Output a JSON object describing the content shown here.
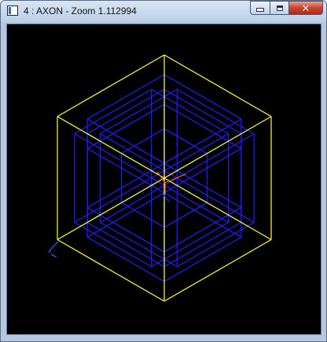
{
  "window": {
    "title": "4 : AXON - Zoom 1.112994",
    "controls": {
      "minimize": "minimize",
      "maximize": "maximize",
      "close": "close"
    }
  },
  "viewport": {
    "background": "#000000",
    "colors": {
      "outer_cube": "#ffff40",
      "inner_cube": "#2020ff",
      "axis_x": "#ff6a00",
      "axis_y": "#ff6a00",
      "axis_z": "#2020ff",
      "ucs_icon": "#4060ff"
    }
  }
}
